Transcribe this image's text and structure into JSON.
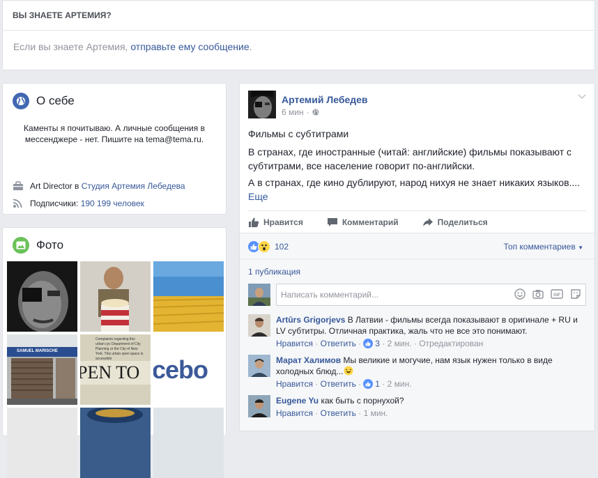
{
  "know": {
    "header": "ВЫ ЗНАЕТЕ АРТЕМИЯ?",
    "text_prefix": "Если вы знаете Артемия, ",
    "link": "отправьте ему сообщение",
    "suffix": "."
  },
  "about": {
    "title": "О себе",
    "bio": "Каменты я почитываю. А личные сообщения в мессенджере - нет. Пишите на tema@tema.ru.",
    "job_prefix": "Art Director в ",
    "job_link": "Студия Артемия Лебедева",
    "subs_prefix": "Подписчики: ",
    "subs_link": "190 199 человек"
  },
  "photos": {
    "title": "Фото",
    "thumb3_text": "",
    "thumb4_text": "SAMUEL MARISCHE",
    "thumb5_text": "PEN TO",
    "thumb5_small": "Complaints regarding this urban cyc Department of City Planning or the City of New York. This urban open space is accessible",
    "thumb6_text": "cebo"
  },
  "post": {
    "author": "Артемий Лебедев",
    "time": "6 мин",
    "title": "Фильмы с субтитрами",
    "para1": "В странах, где иностранные (читай: английские) фильмы показывают с субтитрами, все население говорит по-английски.",
    "para2": "А в странах, где кино дублируют, народ нихуя не знает никаких языков....",
    "more": "Еще",
    "actions": {
      "like": "Нравится",
      "comment": "Комментарий",
      "share": "Поделиться"
    },
    "reaction_count": "102",
    "sort_label": "Топ комментариев",
    "publications": "1 публикация",
    "comment_placeholder": "Написать комментарий...",
    "comments": [
      {
        "author": "Artūrs Grigorjevs",
        "text": "В Латвии - фильмы всегда показывают в оригинале + RU и LV субтитры. Отличная практика, жаль что не все это понимают.",
        "like": "Нравится",
        "reply": "Ответить",
        "likes": "3",
        "time": "2 мин.",
        "edited": "Отредактирован"
      },
      {
        "author": "Марат Халимов",
        "text": "Мы великие и могучие, нам язык нужен только в виде холодных блюд...",
        "like": "Нравится",
        "reply": "Ответить",
        "likes": "1",
        "time": "2 мин."
      },
      {
        "author": "Eugene Yu",
        "text": "как быть с порнухой?",
        "like": "Нравится",
        "reply": "Ответить",
        "time": "1 мин."
      }
    ]
  },
  "colors": {
    "link": "#365899",
    "like_blue": "#5890ff",
    "background": "#e9ebee"
  }
}
